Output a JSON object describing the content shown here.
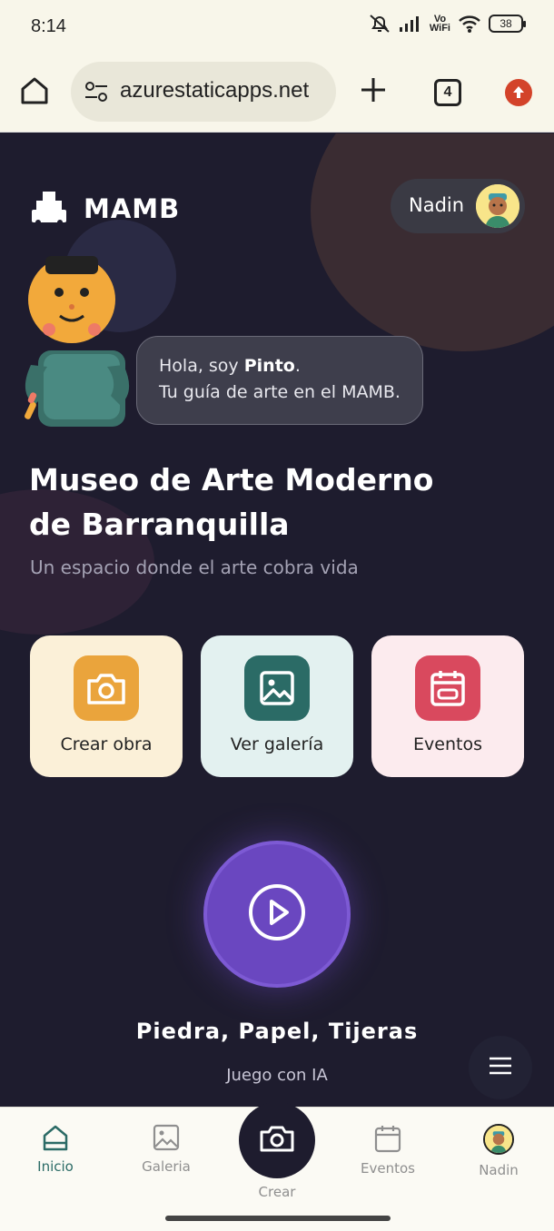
{
  "status_bar": {
    "time": "8:14",
    "vowifi_top": "Vo",
    "vowifi_bottom": "WiFi",
    "battery": "38"
  },
  "browser": {
    "url": "azurestaticapps.net",
    "tab_count": "4"
  },
  "header": {
    "logo_text": "MAMB",
    "user_name": "Nadin"
  },
  "mascot": {
    "greeting_prefix": "Hola, soy ",
    "name": "Pinto",
    "greeting_suffix": ".",
    "tagline": "Tu guía de arte en el MAMB."
  },
  "hero": {
    "title": "Museo de Arte Moderno de Barranquilla",
    "subtitle": "Un espacio donde el arte cobra vida"
  },
  "cards": [
    {
      "label": "Crear obra",
      "bg": "#fbf0d8",
      "icon_bg": "#eaa43c",
      "icon": "camera-icon"
    },
    {
      "label": "Ver galería",
      "bg": "#e3f1f0",
      "icon_bg": "#2b6b66",
      "icon": "image-icon"
    },
    {
      "label": "Eventos",
      "bg": "#fcebee",
      "icon_bg": "#d9495e",
      "icon": "calendar-icon"
    }
  ],
  "game": {
    "title": "Piedra, Papel, Tijeras",
    "subtitle": "Juego con IA"
  },
  "nav": {
    "items": [
      {
        "label": "Inicio",
        "icon": "home-icon"
      },
      {
        "label": "Galeria",
        "icon": "image-icon"
      },
      {
        "label": "Crear",
        "icon": "camera-icon"
      },
      {
        "label": "Eventos",
        "icon": "calendar-icon"
      },
      {
        "label": "Nadin",
        "icon": "avatar"
      }
    ],
    "active": "Inicio",
    "active_color": "#2b6b66"
  }
}
